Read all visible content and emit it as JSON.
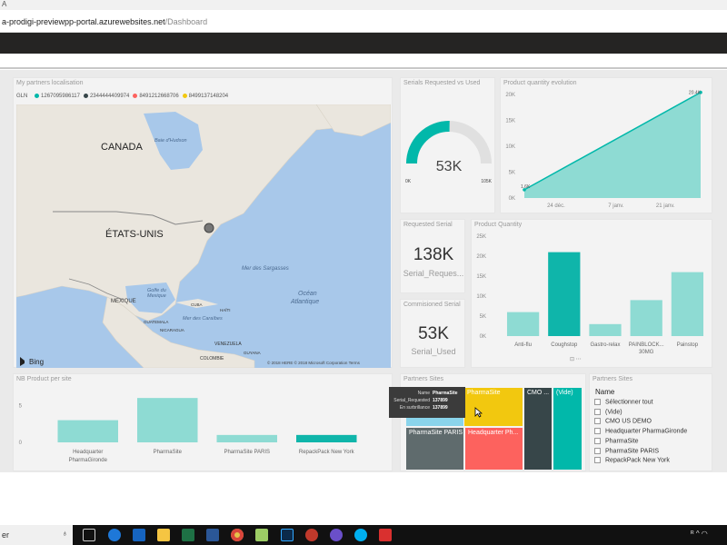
{
  "browser": {
    "top_text": "A",
    "url_host": "a-prodigi-previewpp-portal.azurewebsites.net",
    "url_path": "/Dashboard"
  },
  "map_tile": {
    "title": "My partners localisation",
    "legend_label": "GLN",
    "legend": [
      {
        "label": "1267095986117",
        "color": "#01B8AA"
      },
      {
        "label": "2344444409974",
        "color": "#374649"
      },
      {
        "label": "8491212668706",
        "color": "#FD625E"
      },
      {
        "label": "8499137148204",
        "color": "#F2C80F"
      }
    ],
    "labels": {
      "canada": "CANADA",
      "usa": "ÉTATS-UNIS",
      "mexico": "MEXIQUE",
      "hudson": "Baie d'Hudson",
      "sargasses": "Mer des Sargasses",
      "ocean": "Océan",
      "atlantique": "Atlantique",
      "golfe": "Golfe du",
      "golfe2": "Mexique",
      "cuba": "CUBA",
      "haiti": "HAÏTI",
      "guatemala": "GUATEMALA",
      "nicaragua": "NICARAGUA",
      "caraibes": "Mer des Caraïbes",
      "venezuela": "VENEZUELA",
      "guyana": "GUYANA",
      "colombie": "COLOMBIE"
    },
    "bing": "Bing",
    "copyright": "© 2018 HERE © 2018 Microsoft Corporation  Terms"
  },
  "gauge": {
    "title": "Serials Requested vs Used",
    "value_label": "53K",
    "min": "0K",
    "max": "105K",
    "fraction": 0.505,
    "color": "#01B8AA"
  },
  "line_tile": {
    "title": "Product quantity evolution"
  },
  "requested": {
    "title": "Requested Serial",
    "value": "138K",
    "caption": "Serial_Reques..."
  },
  "commissioned": {
    "title": "Commisioned Serial",
    "value": "53K",
    "caption": "Serial_Used"
  },
  "pq_tile": {
    "title": "Product Quantity"
  },
  "nb_tile": {
    "title": "NB Product per site"
  },
  "treemap": {
    "title": "Partners Sites",
    "cells": [
      {
        "label": "PharmaSite",
        "color": "#F2C80F"
      },
      {
        "label": "CMO ...",
        "color": "#374649"
      },
      {
        "label": "(Vide)",
        "color": "#01B8AA"
      },
      {
        "label": "PharmaSite PARIS",
        "color": "#5F6B6D"
      },
      {
        "label": "Headquarter Ph...",
        "color": "#FD625E"
      },
      {
        "label": "",
        "color": "#8AD4EB"
      }
    ],
    "tooltip": {
      "rows": [
        {
          "k": "Name",
          "v": "PharmaSite"
        },
        {
          "k": "Serial_Requested",
          "v": "137899"
        },
        {
          "k": "En surbrillance",
          "v": "137899"
        }
      ]
    }
  },
  "slicer": {
    "title": "Partners Sites",
    "header": "Name",
    "items": [
      "Sélectionner tout",
      "(Vide)",
      "CMO US DEMO",
      "Headquarter PharmaGironde",
      "PharmaSite",
      "PharmaSite PARIS",
      "RepackPack New York"
    ]
  },
  "taskbar": {
    "search_text": "er"
  },
  "chart_data": [
    {
      "type": "area",
      "title": "Product quantity evolution",
      "x_ticks": [
        "24 déc.",
        "7 janv.",
        "21 janv."
      ],
      "y_ticks": [
        "0K",
        "5K",
        "10K",
        "15K",
        "20K"
      ],
      "ylim": [
        0,
        20000
      ],
      "data_labels": [
        "1.6K",
        "20.4K"
      ],
      "x": [
        0,
        1
      ],
      "y": [
        1600,
        20400
      ],
      "color": "#01B8AA"
    },
    {
      "type": "bar",
      "title": "Product Quantity",
      "categories": [
        "Anti-flu",
        "Coughstop",
        "Gastro-relax",
        "PAINBLOCK... 30MG",
        "Painstop"
      ],
      "values": [
        6000,
        21000,
        3000,
        9000,
        16000
      ],
      "y_ticks": [
        "0K",
        "5K",
        "10K",
        "15K",
        "20K",
        "25K"
      ],
      "ylim": [
        0,
        25000
      ],
      "colors": [
        "#8EDBD3",
        "#0FB5AA",
        "#8EDBD3",
        "#8EDBD3",
        "#8EDBD3"
      ]
    },
    {
      "type": "bar",
      "title": "NB Product per site",
      "categories": [
        "Headquarter PharmaGironde",
        "PharmaSite",
        "PharmaSite PARIS",
        "RepackPack New York"
      ],
      "values": [
        3,
        6,
        1,
        1
      ],
      "y_ticks": [
        "0",
        "5"
      ],
      "ylim": [
        0,
        7
      ],
      "colors": [
        "#8EDBD3",
        "#8EDBD3",
        "#8EDBD3",
        "#0FB5AA"
      ]
    }
  ]
}
